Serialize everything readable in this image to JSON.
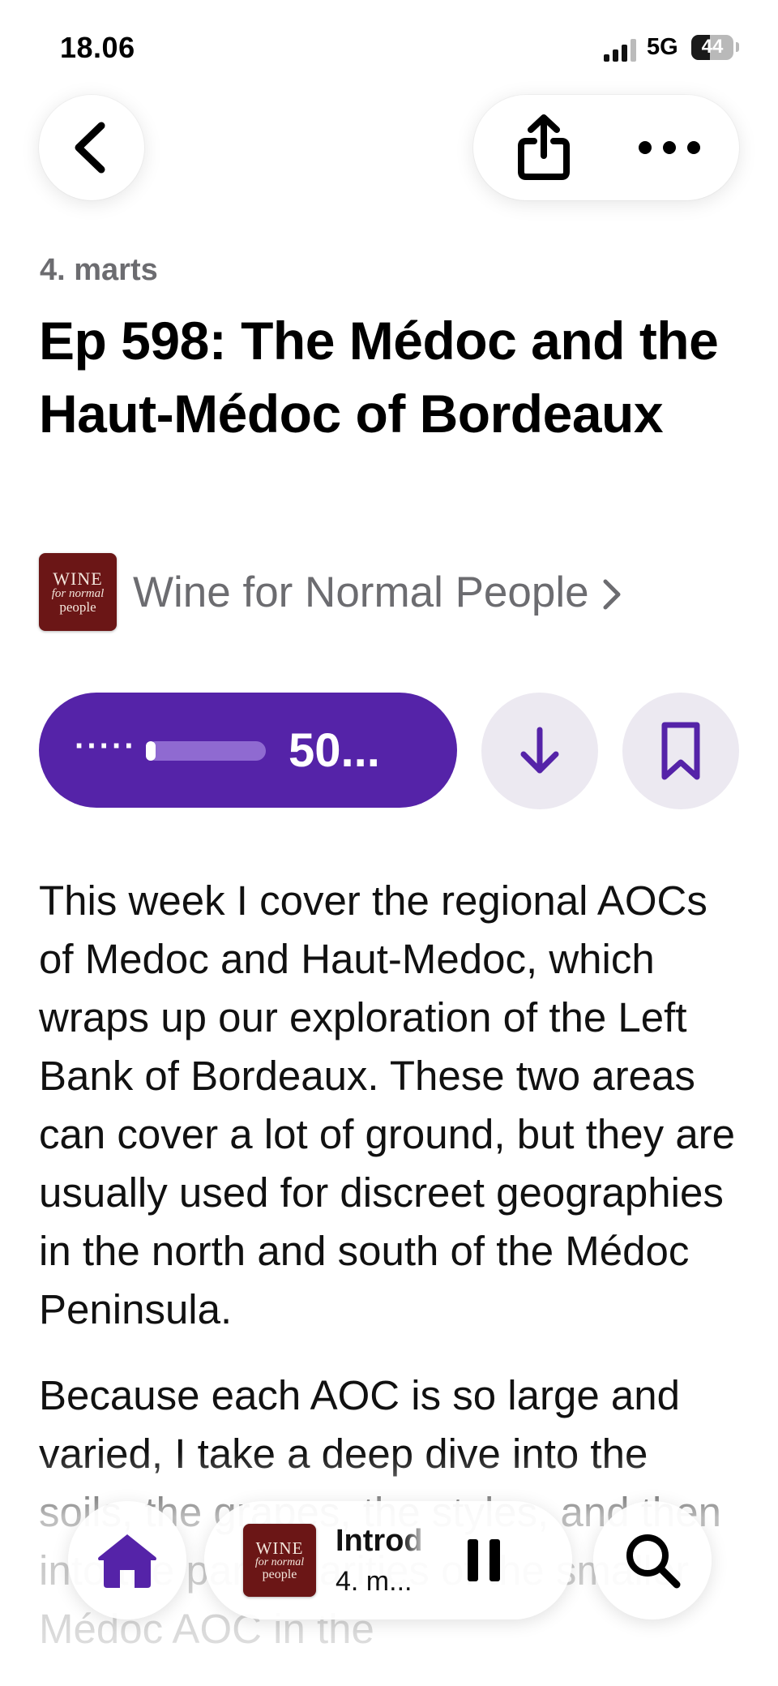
{
  "status_bar": {
    "time": "18.06",
    "network": "5G",
    "battery": "44",
    "battery_level": 0.44
  },
  "nav": {
    "back_icon": "chevron-left-icon",
    "share_icon": "share-icon",
    "more_icon": "ellipsis-icon"
  },
  "episode": {
    "date": "4. marts",
    "title": "Ep 598: The Médoc and the Haut-Médoc of Bordeaux",
    "show_name": "Wine for Normal People",
    "artwork_text": {
      "line1": "WINE",
      "line2": "for normal",
      "line3": "people"
    }
  },
  "player": {
    "dots": "·····",
    "progress_fraction": 0.08,
    "remaining_label": "50...",
    "colors": {
      "accent": "#5523a8",
      "track": "#8f6ad1",
      "circle_bg": "#ece9f1"
    }
  },
  "actions": {
    "download_icon": "arrow-down-icon",
    "bookmark_icon": "bookmark-icon"
  },
  "description": {
    "paragraphs": [
      "This week I cover the regional AOCs of Medoc and Haut-Medoc, which wraps up our exploration of the Left Bank of Bordeaux. These two areas can cover a lot of ground, but they are usually used for discreet geographies in the north and south of the Médoc Peninsula.",
      "Because each AOC is so large and varied, I take a deep dive into the soils, the grapes, the styles, and then into the particularities of the smaller Médoc AOC in the"
    ]
  },
  "mini_player": {
    "title": "Introd",
    "subtitle": "4. m..."
  },
  "tabbar": {
    "home_icon": "home-icon",
    "pause_icon": "pause-icon",
    "search_icon": "search-icon"
  }
}
